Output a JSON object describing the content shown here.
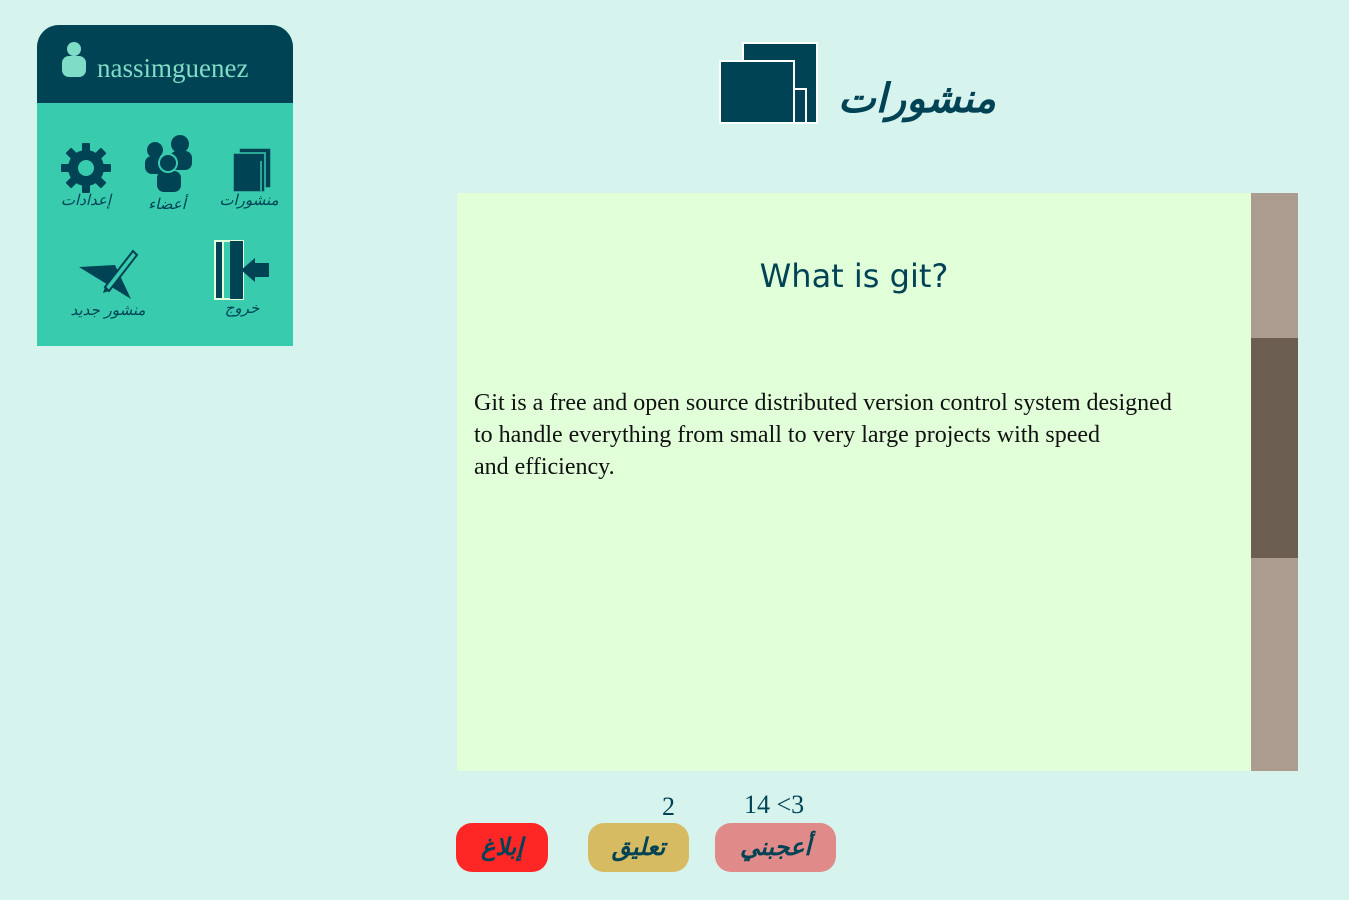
{
  "user": {
    "username": "nassimguenez"
  },
  "menu": {
    "posts_label": "منشورات",
    "members_label": "أعضاء",
    "settings_label": "إعدادات",
    "logout_label": "خروج",
    "new_post_label": "منشور جديد"
  },
  "page": {
    "title": "منشورات"
  },
  "post": {
    "title": "What is git?",
    "body_lines": [
      "Git is a free and open source distributed version control system designed",
      "to handle everything from small to very large projects with speed",
      "and efficiency."
    ]
  },
  "actions": {
    "report_label": "إبلاغ",
    "comment_label": "تعليق",
    "like_label": "أعجبني",
    "comment_count": "2",
    "like_count": "14 <3"
  },
  "scrollbar": {
    "position_fraction": 0.25,
    "visible_fraction": 0.38
  },
  "colors": {
    "background": "#d6f3ee",
    "primary_dark": "#004355",
    "card_green": "#38cbad",
    "post_background": "#e1ffd9",
    "report_button": "#ff2626",
    "comment_button": "#d6bb62",
    "like_button": "#e08a8a",
    "scroll_track": "#ab9c8f",
    "scroll_thumb": "#6c5d51"
  }
}
